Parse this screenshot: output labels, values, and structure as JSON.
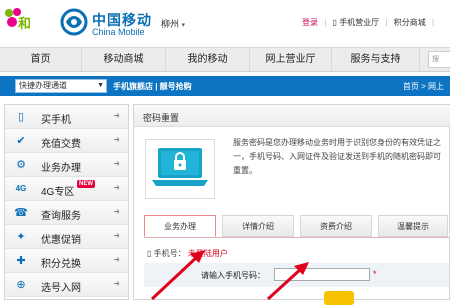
{
  "header": {
    "brand_cn": "中国移动",
    "brand_en": "China Mobile",
    "city": "柳州",
    "city_arrow_icon": "chevron-down-icon",
    "top_links": [
      "登录",
      "手机营业厅",
      "积分商城"
    ]
  },
  "nav": {
    "items": [
      "首页",
      "移动商城",
      "我的移动",
      "网上营业厅",
      "服务与支持"
    ],
    "search_placeholder": "搜"
  },
  "subbar": {
    "quick_select": "快捷办理通道",
    "links": "手机旗舰店 | 靓号抢购",
    "breadcrumb": "首页 > 网上"
  },
  "sidebar": {
    "items": [
      {
        "label": "买手机",
        "icon": "phone-icon"
      },
      {
        "label": "充值交费",
        "icon": "recharge-icon"
      },
      {
        "label": "业务办理",
        "icon": "service-icon"
      },
      {
        "label": "4G专区",
        "icon": "4g-icon",
        "badge": "NEW"
      },
      {
        "label": "查询服务",
        "icon": "query-icon"
      },
      {
        "label": "优惠促销",
        "icon": "promo-icon"
      },
      {
        "label": "积分兑换",
        "icon": "points-icon"
      },
      {
        "label": "选号入网",
        "icon": "number-icon"
      }
    ]
  },
  "content": {
    "title": "密码重置",
    "description": "服务密码是您办理移动业务时用于识别您身份的有效凭证之一，手机号码、入网证件及验证发送到手机的随机密码即可重置。",
    "tabs": [
      "业务办理",
      "详情介绍",
      "资费介绍",
      "温馨提示"
    ],
    "phone_label": "手机号：",
    "phone_value": "未登陆用户",
    "input_label": "请输入手机号码：",
    "input_value": "",
    "required_mark": "*"
  },
  "colors": {
    "brand_blue": "#0a6fb5",
    "subbar_blue": "#0d74c3",
    "accent_red": "#d0021b"
  }
}
